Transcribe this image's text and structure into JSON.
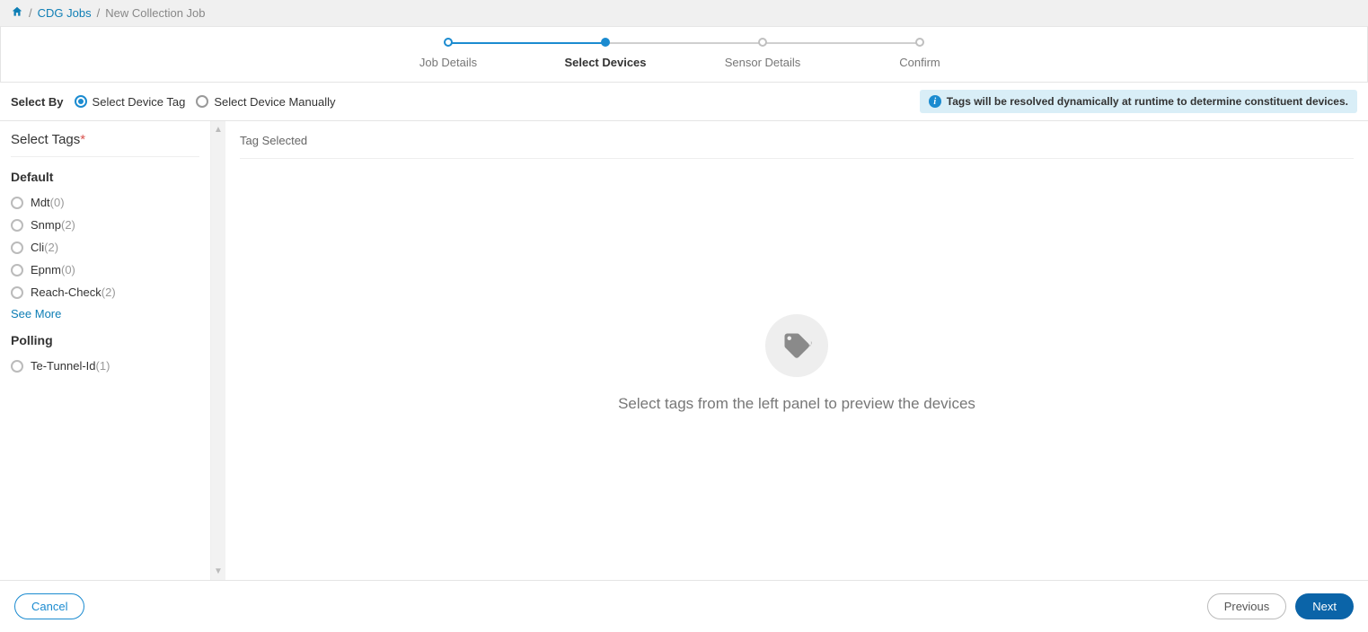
{
  "breadcrumb": {
    "home_icon": "home",
    "links": [
      "CDG Jobs"
    ],
    "current": "New Collection Job"
  },
  "stepper": {
    "steps": [
      {
        "label": "Job Details",
        "state": "done"
      },
      {
        "label": "Select Devices",
        "state": "active"
      },
      {
        "label": "Sensor Details",
        "state": "pending"
      },
      {
        "label": "Confirm",
        "state": "pending"
      }
    ]
  },
  "select_by": {
    "label": "Select By",
    "options": [
      "Select Device Tag",
      "Select Device Manually"
    ],
    "selected_index": 0,
    "info_banner": "Tags will be resolved dynamically at runtime to determine constituent devices."
  },
  "sidebar": {
    "title": "Select Tags",
    "required": true,
    "groups": [
      {
        "title": "Default",
        "items": [
          {
            "name": "Mdt",
            "count": 0
          },
          {
            "name": "Snmp",
            "count": 2
          },
          {
            "name": "Cli",
            "count": 2
          },
          {
            "name": "Epnm",
            "count": 0
          },
          {
            "name": "Reach-Check",
            "count": 2
          }
        ],
        "see_more": "See More"
      },
      {
        "title": "Polling",
        "items": [
          {
            "name": "Te-Tunnel-Id",
            "count": 1
          }
        ]
      }
    ]
  },
  "content": {
    "header": "Tag Selected",
    "empty_message": "Select tags from the left panel to preview the devices"
  },
  "footer": {
    "cancel": "Cancel",
    "previous": "Previous",
    "next": "Next"
  }
}
